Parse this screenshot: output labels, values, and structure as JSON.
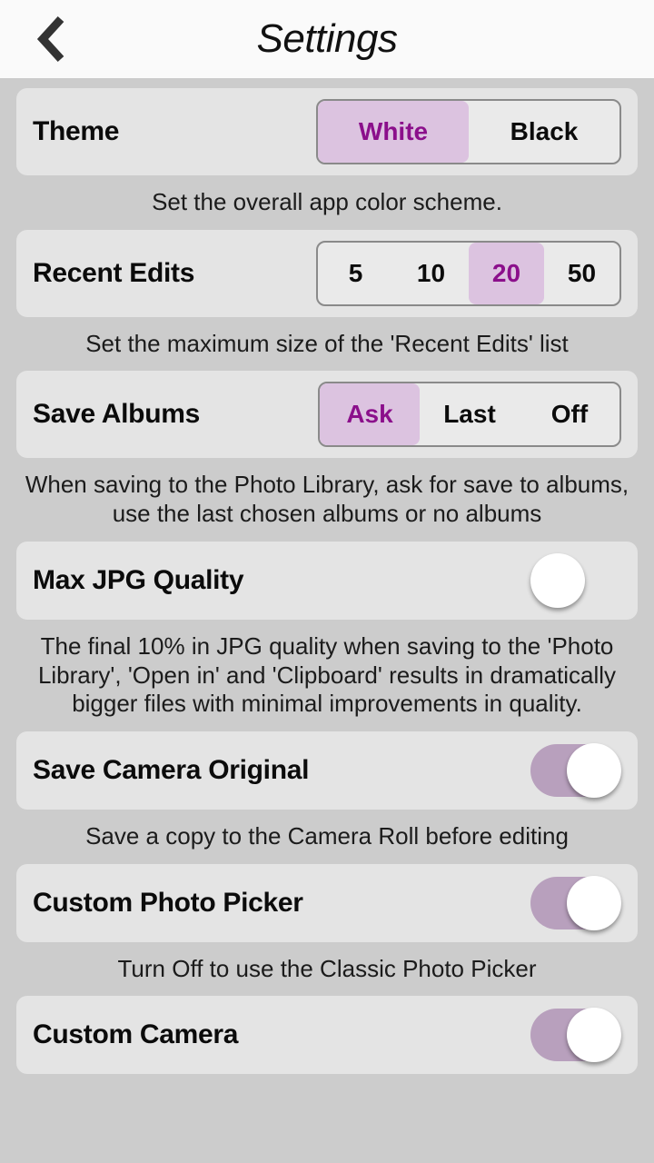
{
  "header": {
    "back_icon": "chevron-left-icon",
    "title": "Settings"
  },
  "settings": {
    "theme": {
      "label": "Theme",
      "type": "segmented",
      "options": [
        "White",
        "Black"
      ],
      "selected": "White",
      "helper": "Set the overall app color scheme."
    },
    "recent_edits": {
      "label": "Recent Edits",
      "type": "segmented",
      "options": [
        "5",
        "10",
        "20",
        "50"
      ],
      "selected": "20",
      "helper": "Set the maximum size of the 'Recent Edits' list"
    },
    "save_albums": {
      "label": "Save Albums",
      "type": "segmented",
      "options": [
        "Ask",
        "Last",
        "Off"
      ],
      "selected": "Ask",
      "helper": "When saving to the Photo Library, ask for save to albums, use the last chosen albums or no albums"
    },
    "max_jpg_quality": {
      "label": "Max JPG Quality",
      "type": "toggle",
      "value": "off",
      "helper": "The final 10% in JPG quality when saving to the 'Photo Library', 'Open in' and 'Clipboard' results in dramatically bigger files with minimal improvements in quality."
    },
    "save_camera_original": {
      "label": "Save Camera Original",
      "type": "toggle",
      "value": "on",
      "helper": "Save a copy to the Camera Roll before editing"
    },
    "custom_photo_picker": {
      "label": "Custom Photo Picker",
      "type": "toggle",
      "value": "on",
      "helper": "Turn Off to use the Classic Photo Picker"
    },
    "custom_camera": {
      "label": "Custom Camera",
      "type": "toggle",
      "value": "on"
    }
  },
  "colors": {
    "page_background": "#cccccc",
    "card_background": "#e4e4e4",
    "navbar_background": "#fafafa",
    "accent_selected_fill": "#dcc3e0",
    "accent_selected_text": "#8b0f8b",
    "toggle_on_track": "#b8a0bd",
    "toggle_knob": "#ffffff",
    "segment_border": "#8a8a8a",
    "label_text": "#0b0b0b"
  }
}
